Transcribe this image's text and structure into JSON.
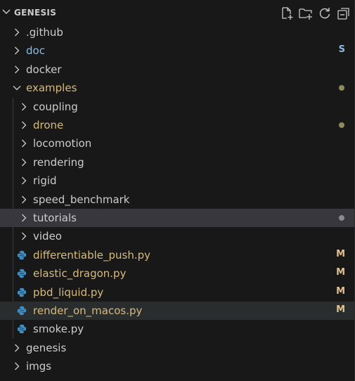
{
  "explorer": {
    "title": "GENESIS",
    "actions": [
      {
        "name": "new-file-icon"
      },
      {
        "name": "new-folder-icon"
      },
      {
        "name": "refresh-icon"
      },
      {
        "name": "collapse-all-icon"
      }
    ]
  },
  "colors": {
    "git_untracked": "#73c991",
    "git_modified": "#e2c08d",
    "folder_text": "#cccccc",
    "modified_folder": "#d7ba7d",
    "submodule_blue": "#8db9e2",
    "dot": "#8f8a5b",
    "dot_grey": "#8a8a8a"
  },
  "tree": [
    {
      "label": ".github",
      "kind": "folder",
      "level": 0,
      "expanded": false
    },
    {
      "label": "doc",
      "kind": "folder",
      "level": 0,
      "expanded": false,
      "badge": "S",
      "color": "blue"
    },
    {
      "label": "docker",
      "kind": "folder",
      "level": 0,
      "expanded": false
    },
    {
      "label": "examples",
      "kind": "folder",
      "level": 0,
      "expanded": true,
      "color": "yellow",
      "dot": "olive"
    },
    {
      "label": "coupling",
      "kind": "folder",
      "level": 1,
      "expanded": false
    },
    {
      "label": "drone",
      "kind": "folder",
      "level": 1,
      "expanded": false,
      "color": "yellow",
      "dot": "olive"
    },
    {
      "label": "locomotion",
      "kind": "folder",
      "level": 1,
      "expanded": false
    },
    {
      "label": "rendering",
      "kind": "folder",
      "level": 1,
      "expanded": false
    },
    {
      "label": "rigid",
      "kind": "folder",
      "level": 1,
      "expanded": false
    },
    {
      "label": "speed_benchmark",
      "kind": "folder",
      "level": 1,
      "expanded": false
    },
    {
      "label": "tutorials",
      "kind": "folder",
      "level": 1,
      "expanded": false,
      "selected": true,
      "dot": "grey"
    },
    {
      "label": "video",
      "kind": "folder",
      "level": 1,
      "expanded": false
    },
    {
      "label": "differentiable_push.py",
      "kind": "py",
      "level": 1,
      "badge": "M",
      "color": "yellow"
    },
    {
      "label": "elastic_dragon.py",
      "kind": "py",
      "level": 1,
      "badge": "M",
      "color": "yellow"
    },
    {
      "label": "pbd_liquid.py",
      "kind": "py",
      "level": 1,
      "badge": "M",
      "color": "yellow"
    },
    {
      "label": "render_on_macos.py",
      "kind": "py",
      "level": 1,
      "badge": "M",
      "color": "yellow",
      "hover": true
    },
    {
      "label": "smoke.py",
      "kind": "py",
      "level": 1
    },
    {
      "label": "genesis",
      "kind": "folder",
      "level": 0,
      "expanded": false
    },
    {
      "label": "imgs",
      "kind": "folder",
      "level": 0,
      "expanded": false
    }
  ]
}
